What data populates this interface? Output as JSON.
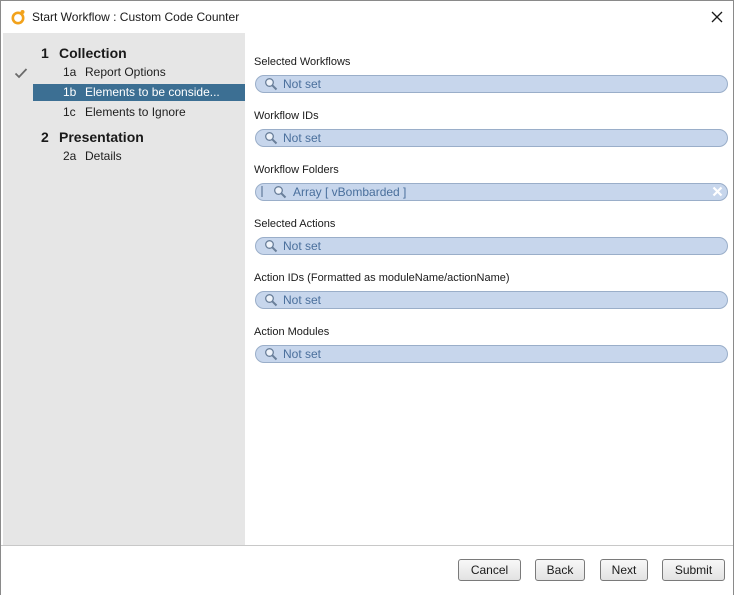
{
  "window": {
    "title": "Start Workflow : Custom Code Counter"
  },
  "sidebar": {
    "groups": [
      {
        "number": "1",
        "label": "Collection",
        "items": [
          {
            "sub": "1a",
            "label": "Report Options",
            "completed": true,
            "selected": false
          },
          {
            "sub": "1b",
            "label": "Elements to be conside...",
            "completed": false,
            "selected": true
          },
          {
            "sub": "1c",
            "label": "Elements to Ignore",
            "completed": false,
            "selected": false
          }
        ]
      },
      {
        "number": "2",
        "label": "Presentation",
        "items": [
          {
            "sub": "2a",
            "label": "Details",
            "completed": false,
            "selected": false
          }
        ]
      }
    ]
  },
  "fields": [
    {
      "label": "Selected Workflows",
      "value": "Not set"
    },
    {
      "label": "Workflow IDs",
      "value": "Not set"
    },
    {
      "label": "Workflow Folders",
      "value": "Array [ vBombarded ]"
    },
    {
      "label": "Selected Actions",
      "value": "Not set"
    },
    {
      "label": "Action IDs (Formatted as moduleName/actionName)",
      "value": "Not set"
    },
    {
      "label": "Action Modules",
      "value": "Not set"
    }
  ],
  "buttons": {
    "cancel": "Cancel",
    "back": "Back",
    "next": "Next",
    "submit": "Submit"
  },
  "icons": {
    "app": "orchestrator-icon",
    "close": "close-icon",
    "check": "checkmark-icon",
    "search": "magnifier-icon",
    "clear": "clear-icon"
  },
  "colors": {
    "sidebar_bg": "#e6e6e6",
    "selected_step": "#3c6f93",
    "field_bg": "#c7d6ec",
    "field_text": "#4a6f9c",
    "app_icon": "#f2a21b"
  }
}
